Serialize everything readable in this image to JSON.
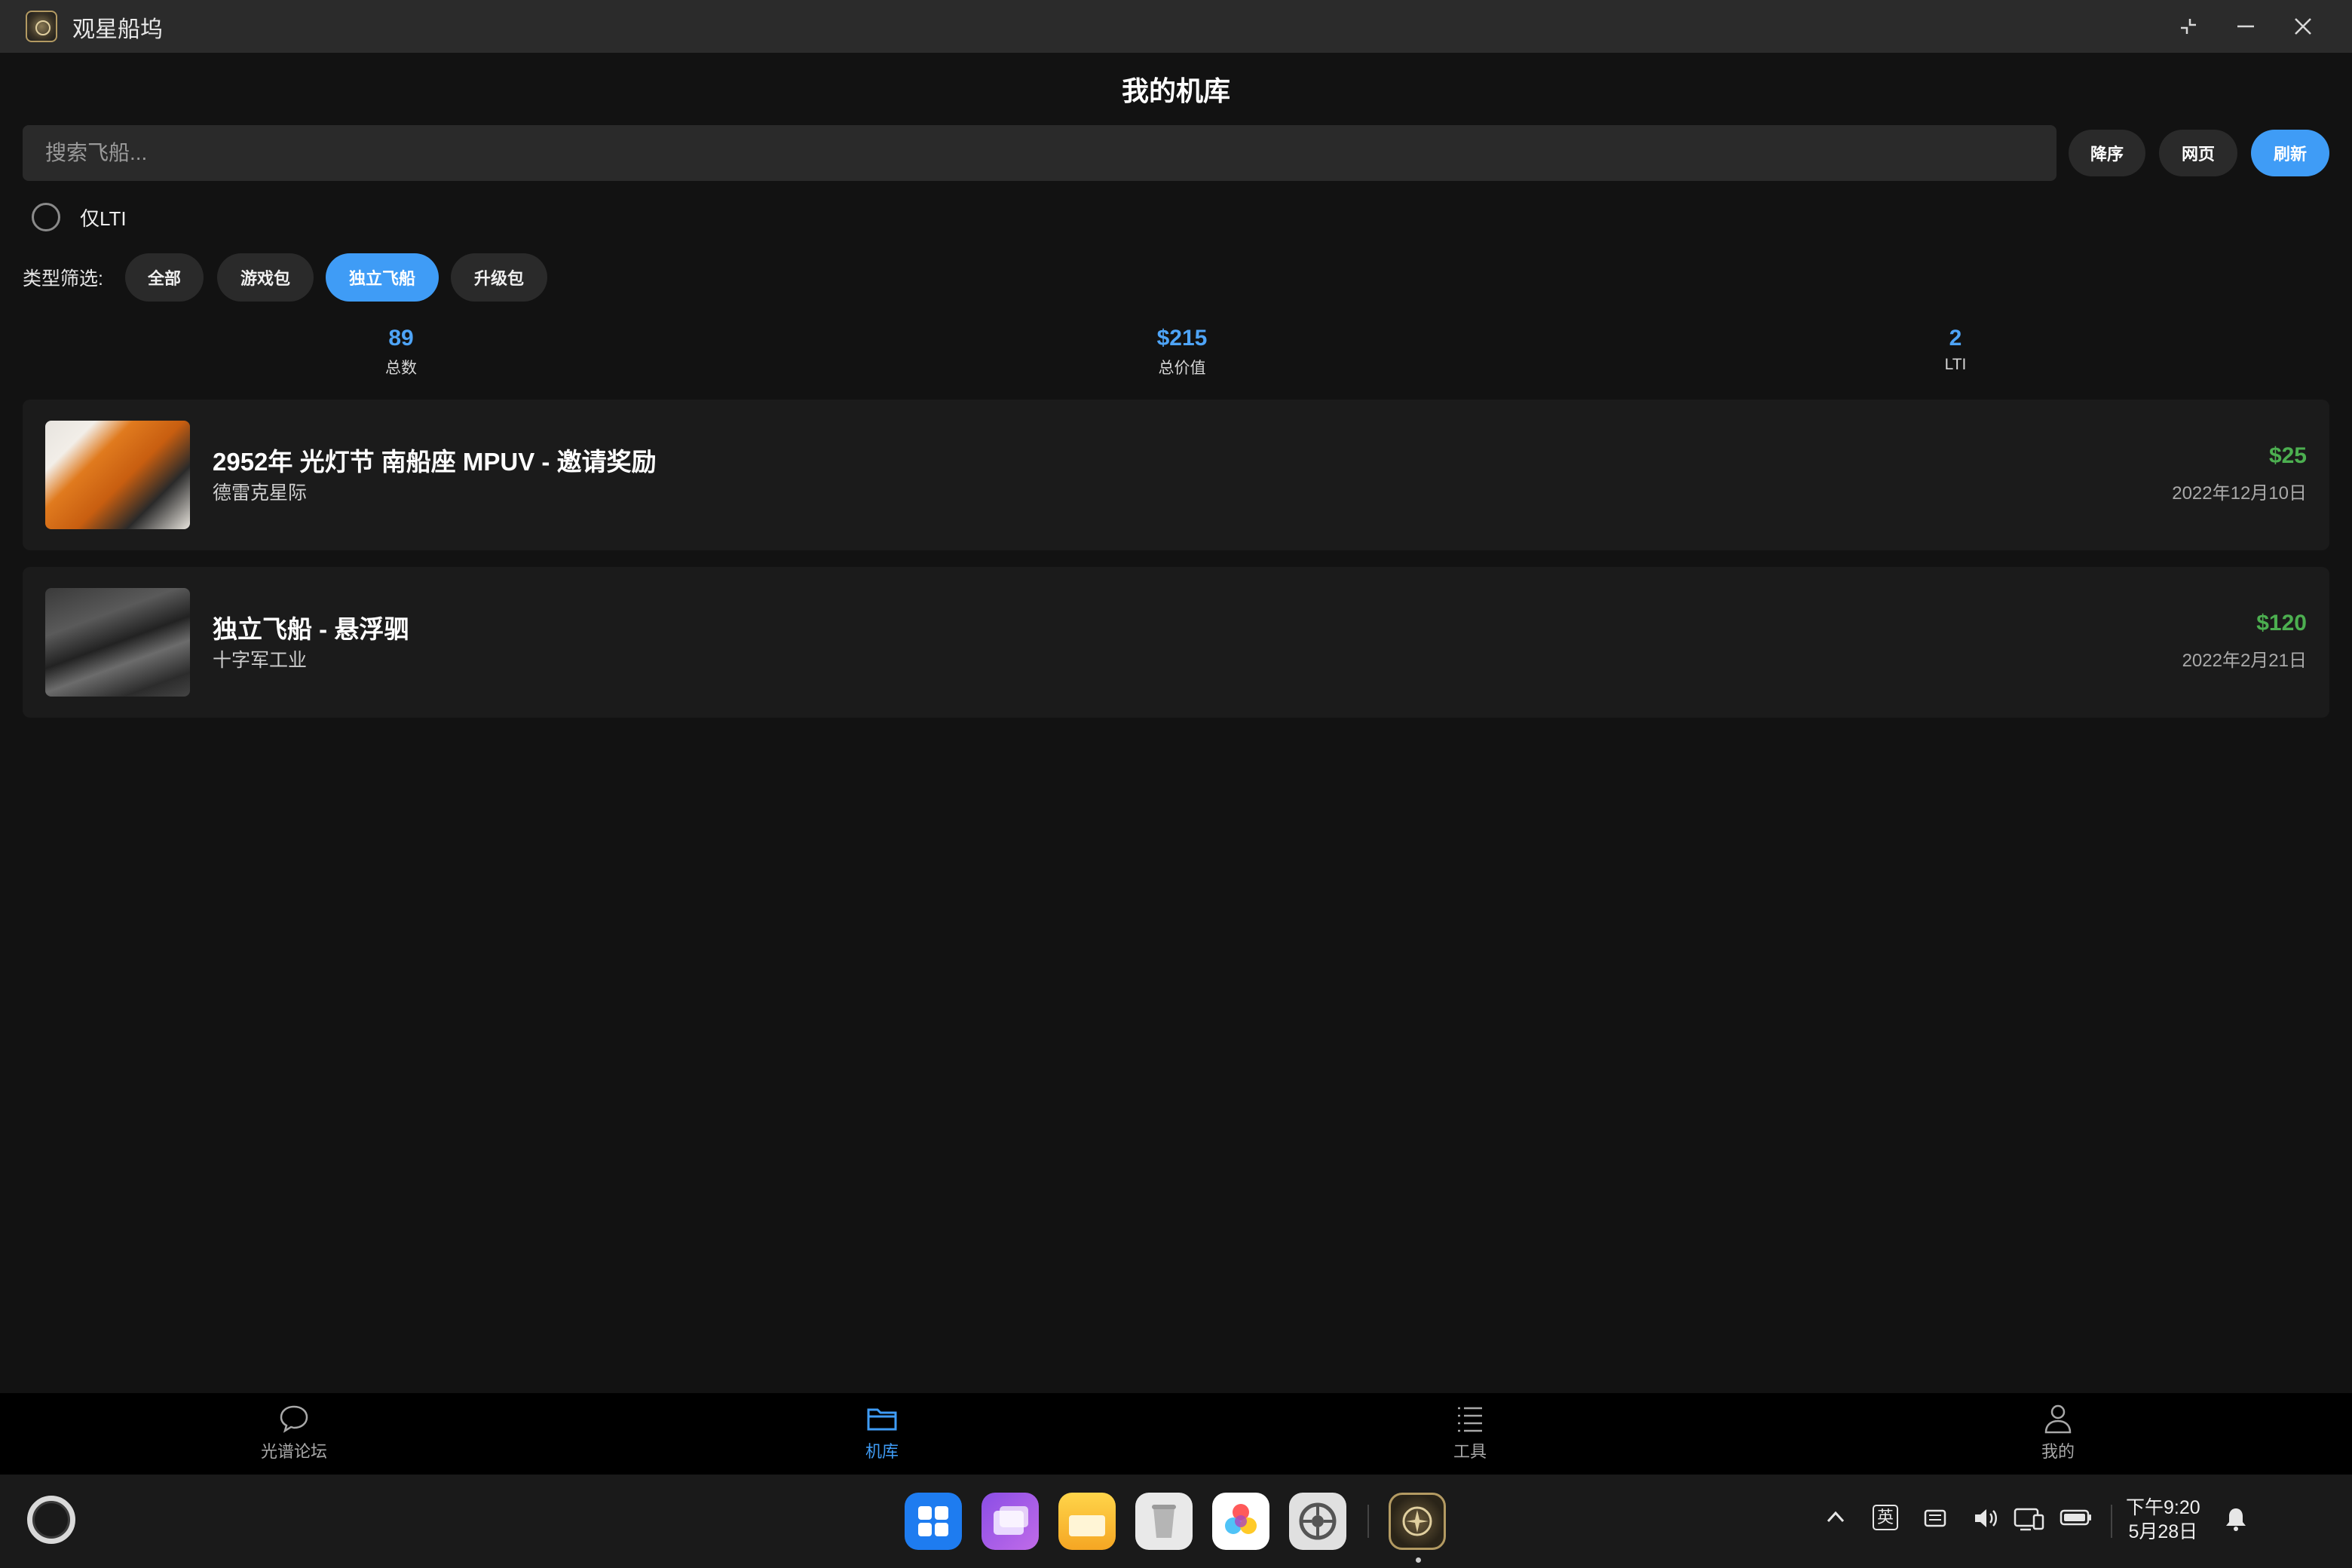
{
  "window": {
    "title": "观星船坞"
  },
  "header": {
    "title": "我的机库"
  },
  "search": {
    "placeholder": "搜索飞船..."
  },
  "actions": {
    "sort": "降序",
    "web": "网页",
    "refresh": "刷新"
  },
  "lti_filter": {
    "label": "仅LTI",
    "checked": false
  },
  "type_filter": {
    "label": "类型筛选:",
    "options": [
      "全部",
      "游戏包",
      "独立飞船",
      "升级包"
    ],
    "selected": "独立飞船"
  },
  "stats": [
    {
      "value": "89",
      "label": "总数"
    },
    {
      "value": "$215",
      "label": "总价值"
    },
    {
      "value": "2",
      "label": "LTI"
    }
  ],
  "ships": [
    {
      "name": "2952年 光灯节 南船座 MPUV - 邀请奖励",
      "manufacturer": "德雷克星际",
      "price": "$25",
      "date": "2022年12月10日",
      "thumb": "orange-ship"
    },
    {
      "name": "独立飞船 - 悬浮驷",
      "manufacturer": "十字军工业",
      "price": "$120",
      "date": "2022年2月21日",
      "thumb": "gray-ship"
    }
  ],
  "tabs": [
    {
      "label": "光谱论坛",
      "icon": "chat-bubble-icon",
      "active": false
    },
    {
      "label": "机库",
      "icon": "folder-icon",
      "active": true
    },
    {
      "label": "工具",
      "icon": "list-icon",
      "active": false
    },
    {
      "label": "我的",
      "icon": "user-icon",
      "active": false
    }
  ],
  "taskbar": {
    "input_method": "英",
    "time": "下午9:20",
    "date": "5月28日"
  },
  "colors": {
    "accent": "#3f9cf6",
    "price": "#4caf50",
    "background": "#121212",
    "card": "#1b1b1b"
  }
}
